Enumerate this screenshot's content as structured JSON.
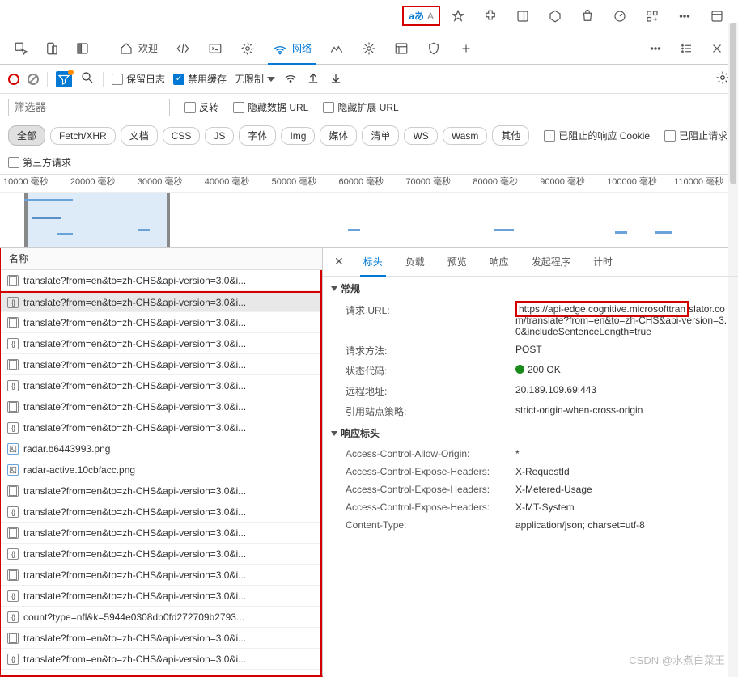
{
  "browser_bar": {
    "translate_label": "aあ",
    "read_aloud": "A"
  },
  "devtools_tabs": {
    "welcome": "欢迎",
    "network": "网络"
  },
  "toolbar": {
    "preserve_log": "保留日志",
    "disable_cache": "禁用缓存",
    "throttle": "无限制"
  },
  "filter": {
    "placeholder": "筛选器",
    "invert": "反转",
    "hide_data_urls": "隐藏数据 URL",
    "hide_ext_urls": "隐藏扩展 URL"
  },
  "types": {
    "all": "全部",
    "fetch": "Fetch/XHR",
    "doc": "文档",
    "css": "CSS",
    "js": "JS",
    "font": "字体",
    "img": "Img",
    "media": "媒体",
    "manifest": "清单",
    "ws": "WS",
    "wasm": "Wasm",
    "other": "其他",
    "blocked_cookies": "已阻止的响应 Cookie",
    "blocked_req": "已阻止请求"
  },
  "third_party": "第三方请求",
  "timeline_ticks": [
    "10000 毫秒",
    "20000 毫秒",
    "30000 毫秒",
    "40000 毫秒",
    "50000 毫秒",
    "60000 毫秒",
    "70000 毫秒",
    "80000 毫秒",
    "90000 毫秒",
    "100000 毫秒",
    "110000 毫秒"
  ],
  "name_col": "名称",
  "requests": [
    {
      "t": "doc",
      "n": "translate?from=en&to=zh-CHS&api-version=3.0&i..."
    },
    {
      "t": "json",
      "n": "translate?from=en&to=zh-CHS&api-version=3.0&i...",
      "sel": true,
      "first": true
    },
    {
      "t": "doc",
      "n": "translate?from=en&to=zh-CHS&api-version=3.0&i..."
    },
    {
      "t": "json",
      "n": "translate?from=en&to=zh-CHS&api-version=3.0&i..."
    },
    {
      "t": "doc",
      "n": "translate?from=en&to=zh-CHS&api-version=3.0&i..."
    },
    {
      "t": "json",
      "n": "translate?from=en&to=zh-CHS&api-version=3.0&i..."
    },
    {
      "t": "doc",
      "n": "translate?from=en&to=zh-CHS&api-version=3.0&i..."
    },
    {
      "t": "json",
      "n": "translate?from=en&to=zh-CHS&api-version=3.0&i..."
    },
    {
      "t": "img",
      "n": "radar.b6443993.png"
    },
    {
      "t": "img",
      "n": "radar-active.10cbfacc.png"
    },
    {
      "t": "doc",
      "n": "translate?from=en&to=zh-CHS&api-version=3.0&i..."
    },
    {
      "t": "json",
      "n": "translate?from=en&to=zh-CHS&api-version=3.0&i..."
    },
    {
      "t": "doc",
      "n": "translate?from=en&to=zh-CHS&api-version=3.0&i..."
    },
    {
      "t": "json",
      "n": "translate?from=en&to=zh-CHS&api-version=3.0&i..."
    },
    {
      "t": "doc",
      "n": "translate?from=en&to=zh-CHS&api-version=3.0&i..."
    },
    {
      "t": "json",
      "n": "translate?from=en&to=zh-CHS&api-version=3.0&i..."
    },
    {
      "t": "json",
      "n": "count?type=nfl&k=5944e0308db0fd272709b2793..."
    },
    {
      "t": "doc",
      "n": "translate?from=en&to=zh-CHS&api-version=3.0&i..."
    },
    {
      "t": "json",
      "n": "translate?from=en&to=zh-CHS&api-version=3.0&i..."
    }
  ],
  "detail_tabs": {
    "headers": "标头",
    "payload": "负载",
    "preview": "预览",
    "response": "响应",
    "initiator": "发起程序",
    "timing": "计时"
  },
  "general": {
    "title": "常规",
    "url_k": "请求 URL:",
    "url_v1": "https://api-edge.cognitive.microsofttran",
    "url_v2": "slator.com/translate?from=en&to=zh-CHS&api-version=3.0&includeSentenceLength=true",
    "method_k": "请求方法:",
    "method_v": "POST",
    "status_k": "状态代码:",
    "status_v": "200 OK",
    "remote_k": "远程地址:",
    "remote_v": "20.189.109.69:443",
    "referrer_k": "引用站点策略:",
    "referrer_v": "strict-origin-when-cross-origin"
  },
  "resp_headers": {
    "title": "响应标头",
    "rows": [
      {
        "k": "Access-Control-Allow-Origin:",
        "v": "*"
      },
      {
        "k": "Access-Control-Expose-Headers:",
        "v": "X-RequestId"
      },
      {
        "k": "Access-Control-Expose-Headers:",
        "v": "X-Metered-Usage"
      },
      {
        "k": "Access-Control-Expose-Headers:",
        "v": "X-MT-System"
      },
      {
        "k": "Content-Type:",
        "v": "application/json; charset=utf-8"
      }
    ]
  },
  "watermark": "CSDN @水煮白菜王"
}
